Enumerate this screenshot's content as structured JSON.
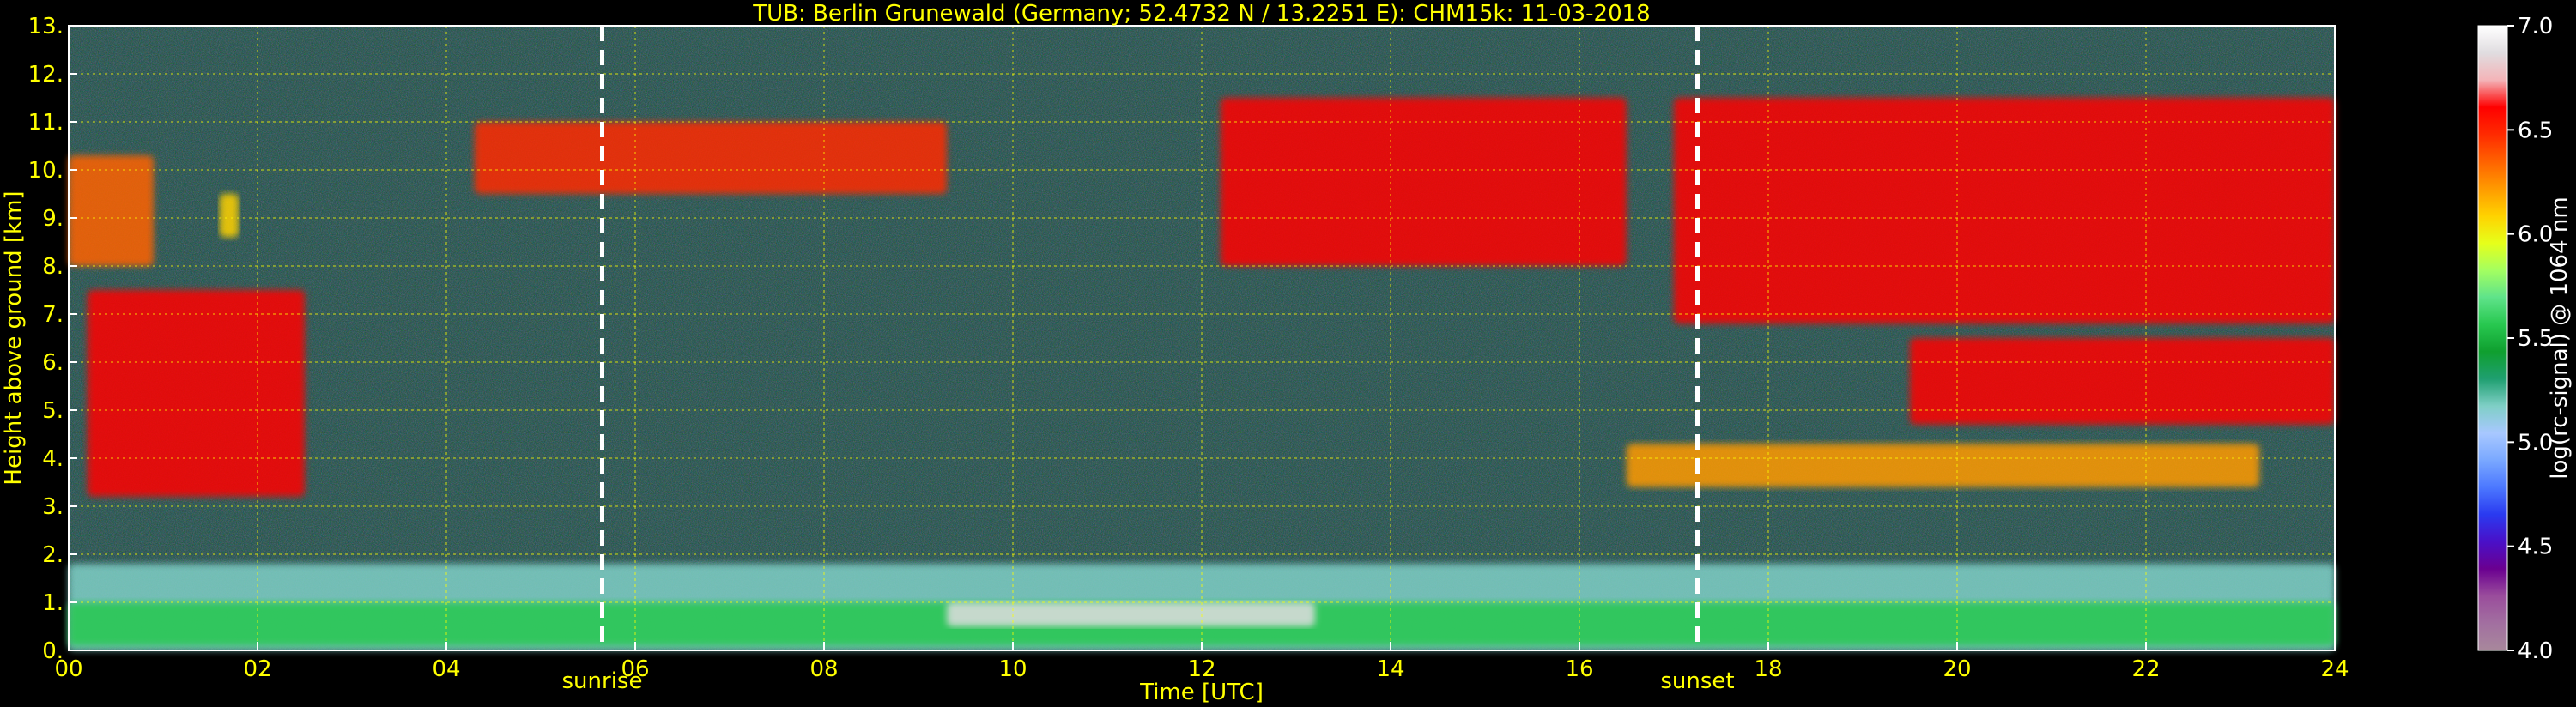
{
  "chart_data": {
    "type": "heatmap",
    "title": "TUB: Berlin Grunewald (Germany; 52.4732 N / 13.2251 E):    CHM15k: 11-03-2018",
    "xlabel": "Time [UTC]",
    "ylabel": "Height above ground [km]",
    "xlim": [
      0,
      24
    ],
    "ylim": [
      0,
      13
    ],
    "x_ticks": [
      0,
      2,
      4,
      6,
      8,
      10,
      12,
      14,
      16,
      18,
      20,
      22,
      24
    ],
    "x_tick_labels": [
      "00",
      "02",
      "04",
      "06",
      "08",
      "10",
      "12",
      "14",
      "16",
      "18",
      "20",
      "22",
      "24"
    ],
    "y_ticks": [
      0,
      1,
      2,
      3,
      4,
      5,
      6,
      7,
      8,
      9,
      10,
      11,
      12,
      13
    ],
    "y_tick_labels": [
      "0.",
      "1.",
      "2.",
      "3.",
      "4.",
      "5.",
      "6.",
      "7.",
      "8.",
      "9.",
      "10.",
      "11.",
      "12.",
      "13."
    ],
    "grid": true,
    "markers": [
      {
        "label": "sunrise",
        "time": 5.65
      },
      {
        "label": "sunset",
        "time": 17.25
      }
    ],
    "colorbar": {
      "label": "log(rc-signal) @ 1064 nm",
      "range": [
        4.0,
        7.0
      ],
      "ticks": [
        4.0,
        4.5,
        5.0,
        5.5,
        6.0,
        6.5,
        7.0
      ],
      "tick_labels": [
        "4.0",
        "4.5",
        "5.0",
        "5.5",
        "6.0",
        "6.5",
        "7.0"
      ],
      "colors": [
        "#a8889c",
        "#a26fa0",
        "#9a4d9c",
        "#6a0090",
        "#4a10c8",
        "#2a3af0",
        "#4c78ff",
        "#7aa8ff",
        "#a8c8ff",
        "#7fcfc6",
        "#1f9f70",
        "#0f9f2f",
        "#28c850",
        "#5fe38a",
        "#a4ff60",
        "#e6ff1a",
        "#ffd200",
        "#ff9a00",
        "#ff6200",
        "#ff2a00",
        "#ff0000",
        "#f4b4b8",
        "#e0dde0",
        "#ffffff"
      ]
    },
    "features": [
      {
        "name": "cloud_night",
        "t0": 0.0,
        "t1": 0.9,
        "h0": 8.0,
        "h1": 10.3,
        "v": 6.3
      },
      {
        "name": "cloud_descending",
        "t0": 0.2,
        "t1": 2.5,
        "h0": 3.2,
        "h1": 7.5,
        "v": 6.6
      },
      {
        "name": "cloud_small",
        "t0": 1.6,
        "t1": 1.8,
        "h0": 8.6,
        "h1": 9.5,
        "v": 6.0
      },
      {
        "name": "cirrus_morning",
        "t0": 4.3,
        "t1": 9.3,
        "h0": 9.5,
        "h1": 11.0,
        "v": 6.4
      },
      {
        "name": "cirrus_afternoon",
        "t0": 12.2,
        "t1": 16.5,
        "h0": 8.0,
        "h1": 11.5,
        "v": 6.5
      },
      {
        "name": "cirrus_evening",
        "t0": 17.0,
        "t1": 24.0,
        "h0": 6.8,
        "h1": 11.5,
        "v": 6.6
      },
      {
        "name": "cloud_midlevel_evening",
        "t0": 19.5,
        "t1": 24.0,
        "h0": 4.7,
        "h1": 6.5,
        "v": 6.6
      },
      {
        "name": "cloud_low_evening",
        "t0": 16.5,
        "t1": 23.2,
        "h0": 3.4,
        "h1": 4.3,
        "v": 6.2
      },
      {
        "name": "boundary_layer",
        "t0": 0.0,
        "t1": 24.0,
        "h0": 0.0,
        "h1": 1.8,
        "v": 5.2
      },
      {
        "name": "surface_layer",
        "t0": 0.0,
        "t1": 24.0,
        "h0": 0.1,
        "h1": 1.0,
        "v": 5.5
      },
      {
        "name": "low_cloud_midday",
        "t0": 9.3,
        "t1": 13.2,
        "h0": 0.5,
        "h1": 1.0,
        "v": 6.8
      }
    ]
  }
}
